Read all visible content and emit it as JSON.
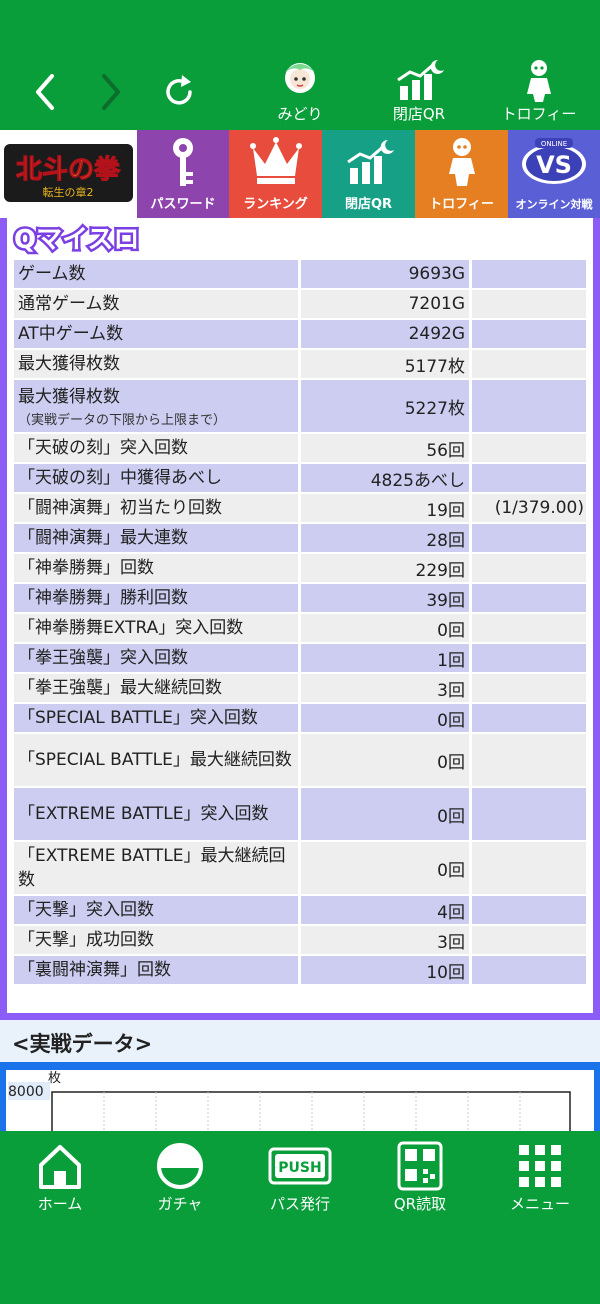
{
  "nav": {
    "back_icon": "chevron-left-icon",
    "forward_icon": "chevron-right-icon",
    "reload_icon": "reload-icon",
    "items": [
      {
        "label": "みどり",
        "icon": "character-avatar-icon"
      },
      {
        "label": "閉店QR",
        "icon": "chart-moon-icon"
      },
      {
        "label": "トロフィー",
        "icon": "trophy-figure-icon"
      }
    ]
  },
  "categories": {
    "logo_text": "北斗の拳",
    "logo_sub": "転生の章2",
    "items": [
      {
        "label": "パスワード",
        "color": "#8e44ad"
      },
      {
        "label": "ランキング",
        "color": "#e74c3c"
      },
      {
        "label": "閉店QR",
        "color": "#16a085"
      },
      {
        "label": "トロフィー",
        "color": "#e67e22"
      },
      {
        "label": "オンライン対戦",
        "color": "#5b5fd6",
        "badge_top": "ONLINE",
        "badge": "VS"
      }
    ]
  },
  "section_logo": "Qマイスロ",
  "stats": [
    {
      "label": "ゲーム数",
      "value": "9693G",
      "extra": ""
    },
    {
      "label": "通常ゲーム数",
      "value": "7201G",
      "extra": ""
    },
    {
      "label": "AT中ゲーム数",
      "value": "2492G",
      "extra": ""
    },
    {
      "label": "最大獲得枚数",
      "value": "5177枚",
      "extra": ""
    },
    {
      "label": "最大獲得枚数",
      "sub": "（実戦データの下限から上限まで）",
      "value": "5227枚",
      "extra": ""
    },
    {
      "label": "「天破の刻」突入回数",
      "value": "56回",
      "extra": ""
    },
    {
      "label": "「天破の刻」中獲得あべし",
      "value": "4825あべし",
      "extra": ""
    },
    {
      "label": "「闘神演舞」初当たり回数",
      "value": "19回",
      "extra": "(1/379.00)"
    },
    {
      "label": "「闘神演舞」最大連数",
      "value": "28回",
      "extra": ""
    },
    {
      "label": "「神拳勝舞」回数",
      "value": "229回",
      "extra": ""
    },
    {
      "label": "「神拳勝舞」勝利回数",
      "value": "39回",
      "extra": ""
    },
    {
      "label": "「神拳勝舞EXTRA」突入回数",
      "value": "0回",
      "extra": ""
    },
    {
      "label": "「拳王強襲」突入回数",
      "value": "1回",
      "extra": ""
    },
    {
      "label": "「拳王強襲」最大継続回数",
      "value": "3回",
      "extra": ""
    },
    {
      "label": "「SPECIAL BATTLE」突入回数",
      "value": "0回",
      "extra": ""
    },
    {
      "label": "「SPECIAL BATTLE」最大継続回数",
      "value": "0回",
      "extra": ""
    },
    {
      "label": "「EXTREME BATTLE」突入回数",
      "value": "0回",
      "extra": ""
    },
    {
      "label": "「EXTREME BATTLE」最大継続回数",
      "value": "0回",
      "extra": ""
    },
    {
      "label": "「天撃」突入回数",
      "value": "4回",
      "extra": ""
    },
    {
      "label": "「天撃」成功回数",
      "value": "3回",
      "extra": ""
    },
    {
      "label": "「裏闘神演舞」回数",
      "value": "10回",
      "extra": ""
    }
  ],
  "jissen": {
    "title": "<実戦データ>",
    "unit": "枚",
    "y_max_label": "8000"
  },
  "bottom_nav": [
    {
      "label": "ホーム",
      "icon": "home-icon"
    },
    {
      "label": "ガチャ",
      "icon": "gacha-capsule-icon"
    },
    {
      "label": "パス発行",
      "icon": "push-pass-icon"
    },
    {
      "label": "QR読取",
      "icon": "qr-code-icon"
    },
    {
      "label": "メニュー",
      "icon": "grid-menu-icon"
    }
  ],
  "colors": {
    "brand_green": "#0a9e3b",
    "frame_purple": "#8b5cf6",
    "row_lavender": "#cccdf0",
    "row_gray": "#eeeeee"
  }
}
